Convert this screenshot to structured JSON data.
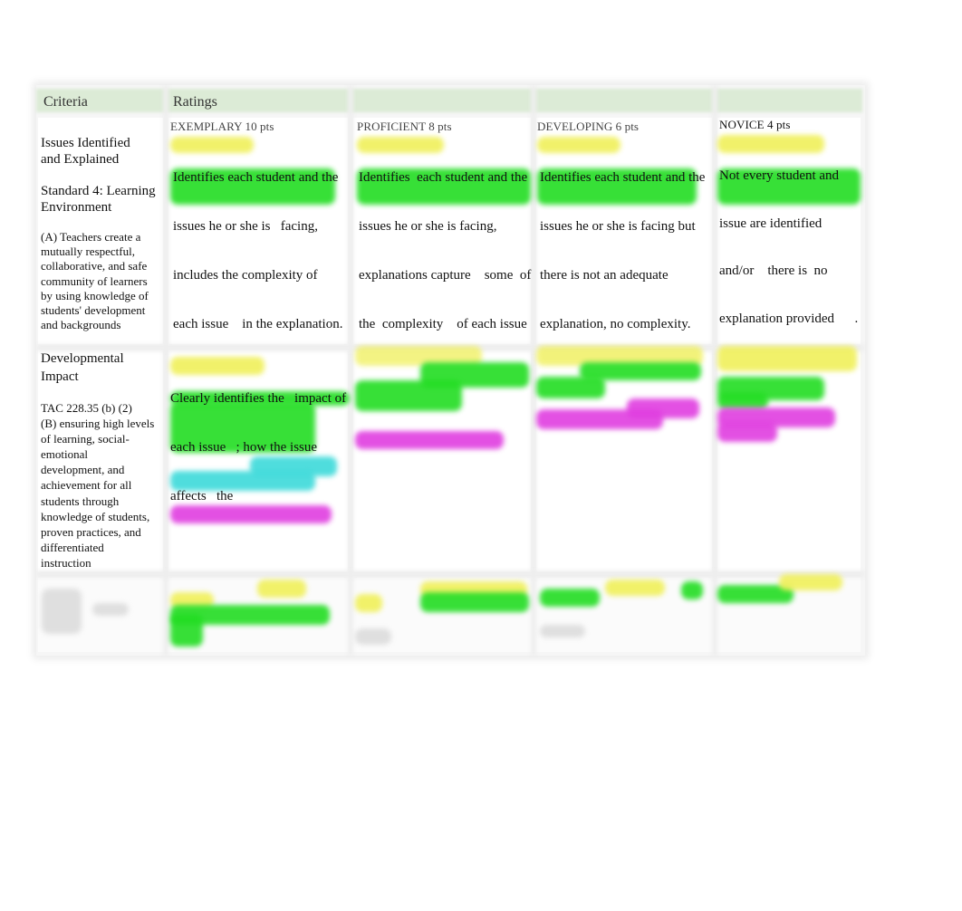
{
  "rubric": {
    "header": {
      "criteria_label": "Criteria",
      "ratings_label": "Ratings"
    },
    "levels": [
      {
        "label": "EXEMPLARY 10 pts"
      },
      {
        "label": "PROFICIENT 8 pts"
      },
      {
        "label": "DEVELOPING 6 pts"
      },
      {
        "label": "NOVICE 4 pts"
      }
    ],
    "rows": [
      {
        "criterion_title": [
          "Issues Identified",
          "and Explained"
        ],
        "standard": [
          "Standard 4: Learning",
          "Environment"
        ],
        "standard_detail": [
          "(A) Teachers create a",
          "mutually respectful,",
          "collaborative, and safe",
          "community of learners",
          "by using knowledge of",
          "students' development",
          "and backgrounds"
        ],
        "ratings": [
          [
            "Identifies each student and the",
            "issues he or she is   facing,",
            "includes the complexity of",
            "each issue    in the explanation."
          ],
          [
            "Identifies  each student and the",
            "issues he or she is facing,",
            "explanations capture    some  of",
            "the  complexity    of each issue"
          ],
          [
            "Identifies each student and the",
            "issues he or she is facing but",
            "there is not an adequate",
            "explanation, no complexity."
          ],
          [
            "Not every student and",
            "issue are identified",
            "and/or    there is  no",
            "explanation provided      ."
          ]
        ]
      },
      {
        "criterion_title": [
          "Developmental",
          "Impact"
        ],
        "standard_detail": [
          "TAC 228.35 (b) (2)",
          "(B) ensuring high levels",
          "of learning, social-",
          "emotional",
          "development, and",
          "achievement for all",
          "students through",
          "knowledge of students,",
          "proven practices, and",
          "differentiated",
          "instruction"
        ],
        "ratings": [
          [
            "Clearly identifies the   impact of",
            "each issue   ; how the issue",
            "affects   the"
          ]
        ]
      }
    ]
  },
  "highlight_colors": {
    "yellow": "#f0f05a",
    "green": "#22dd22",
    "cyan": "#3ddada",
    "magenta": "#e03ee0"
  }
}
